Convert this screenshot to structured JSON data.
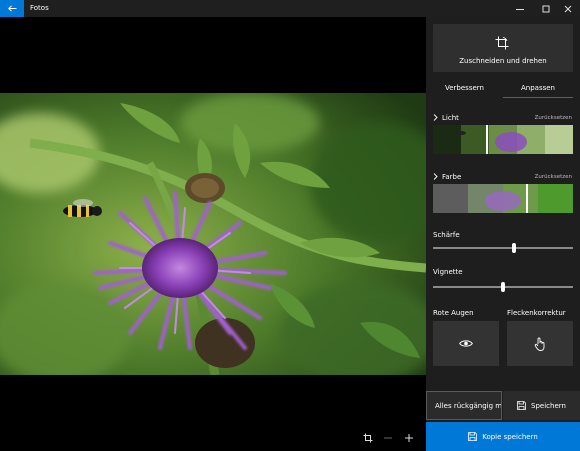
{
  "app": {
    "title": "Fotos"
  },
  "window": {
    "minimize_icon": "minimize-icon",
    "maximize_icon": "maximize-icon",
    "close_icon": "close-icon"
  },
  "viewer": {
    "tools": [
      "crop-icon",
      "zoom-out-icon",
      "zoom-in-icon"
    ]
  },
  "panel": {
    "crop_rotate_label": "Zuschneiden und drehen",
    "tabs": [
      {
        "label": "Verbessern",
        "active": false
      },
      {
        "label": "Anpassen",
        "active": true
      }
    ],
    "light": {
      "label": "Licht",
      "reset": "Zurücksetzen"
    },
    "color": {
      "label": "Farbe",
      "reset": "Zurücksetzen"
    },
    "sharpness": {
      "label": "Schärfe",
      "value": 0.58
    },
    "vignette": {
      "label": "Vignette",
      "value": 0.5
    },
    "red_eye": {
      "label": "Rote Augen"
    },
    "spot_fix": {
      "label": "Fleckenkorrektur"
    },
    "undo_all_label": "Alles rückgängig m",
    "save_label": "Speichern",
    "save_copy_label": "Kopie speichern"
  },
  "colors": {
    "accent": "#0078d7",
    "panel_bg": "#1e1e1e",
    "button_bg": "#2f2f2f"
  }
}
